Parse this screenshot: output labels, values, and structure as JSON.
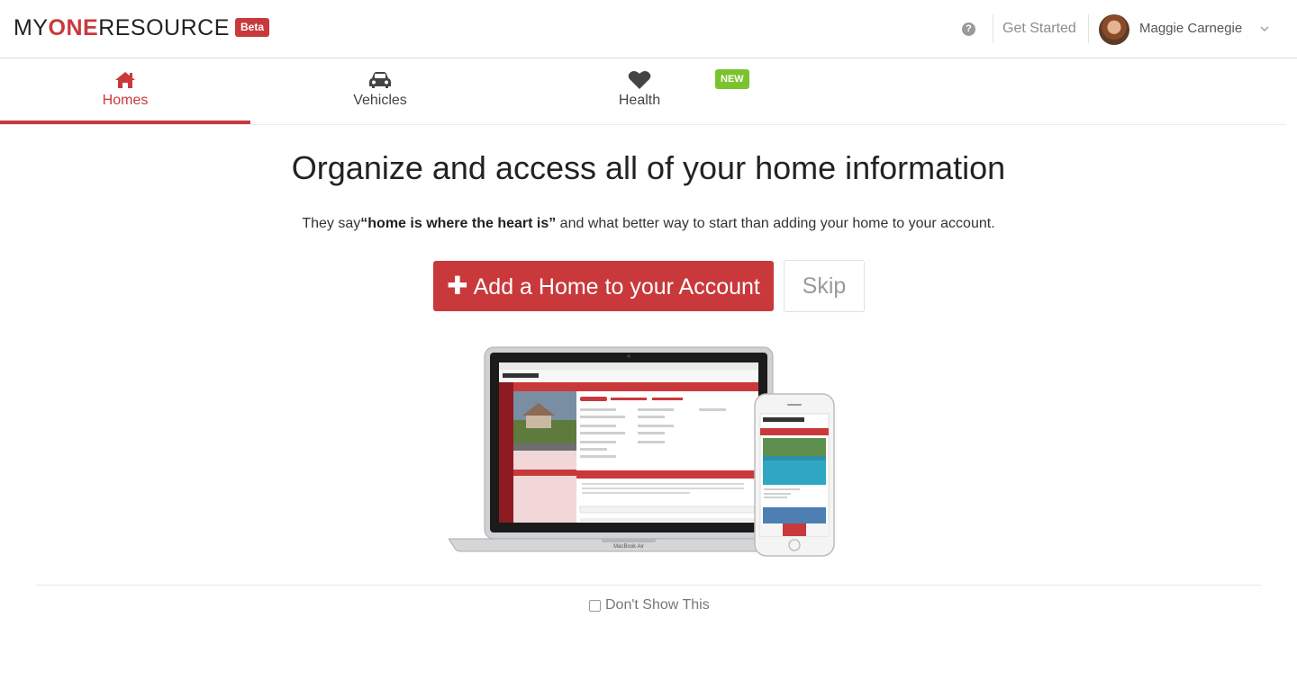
{
  "header": {
    "logo_prefix": "MY",
    "logo_highlight": "ONE",
    "logo_suffix": "RESOURCE",
    "beta_badge": "Beta",
    "help_icon": "?",
    "get_started": "Get Started",
    "user_name": "Maggie Carnegie",
    "chevron": "⌄"
  },
  "tabs": [
    {
      "label": "Homes",
      "icon": "home-icon",
      "active": true
    },
    {
      "label": "Vehicles",
      "icon": "car-icon",
      "active": false
    },
    {
      "label": "Health",
      "icon": "heart-icon",
      "active": false
    }
  ],
  "new_badge": "NEW",
  "main": {
    "headline": "Organize and access all of your home information",
    "sub_prefix": "They say",
    "sub_bold": "“home is where the heart is”",
    "sub_suffix": " and what better way to start than adding your home to your account.",
    "add_button": "Add a Home to your Account",
    "skip_button": "Skip"
  },
  "preview": {
    "laptop_label": "MacBook Air"
  },
  "footer": {
    "dont_show": "Don't Show This"
  },
  "colors": {
    "brand_red": "#c9393c",
    "new_green": "#7ac32e"
  }
}
